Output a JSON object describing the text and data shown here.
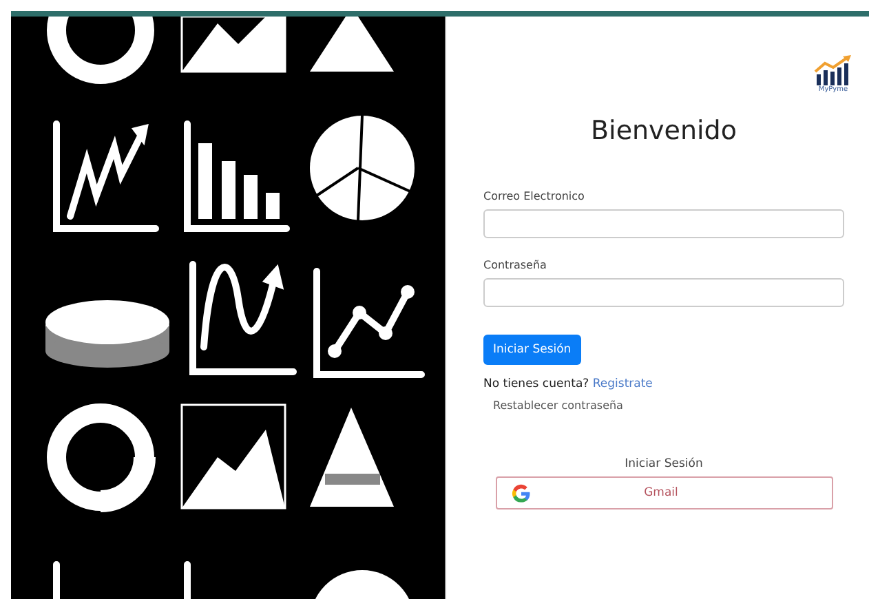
{
  "logo": {
    "text": "MyPyme"
  },
  "title": "Bienvenido",
  "fields": [
    {
      "label": "Correo Electronico"
    },
    {
      "label": "Contraseña"
    }
  ],
  "submit_button": "Iniciar Sesión",
  "register": {
    "text": "No tienes cuenta?",
    "link": "Registrate"
  },
  "reset_link": "Restablecer contraseña",
  "social": {
    "heading": "Iniciar Sesión",
    "button": "Gmail"
  }
}
